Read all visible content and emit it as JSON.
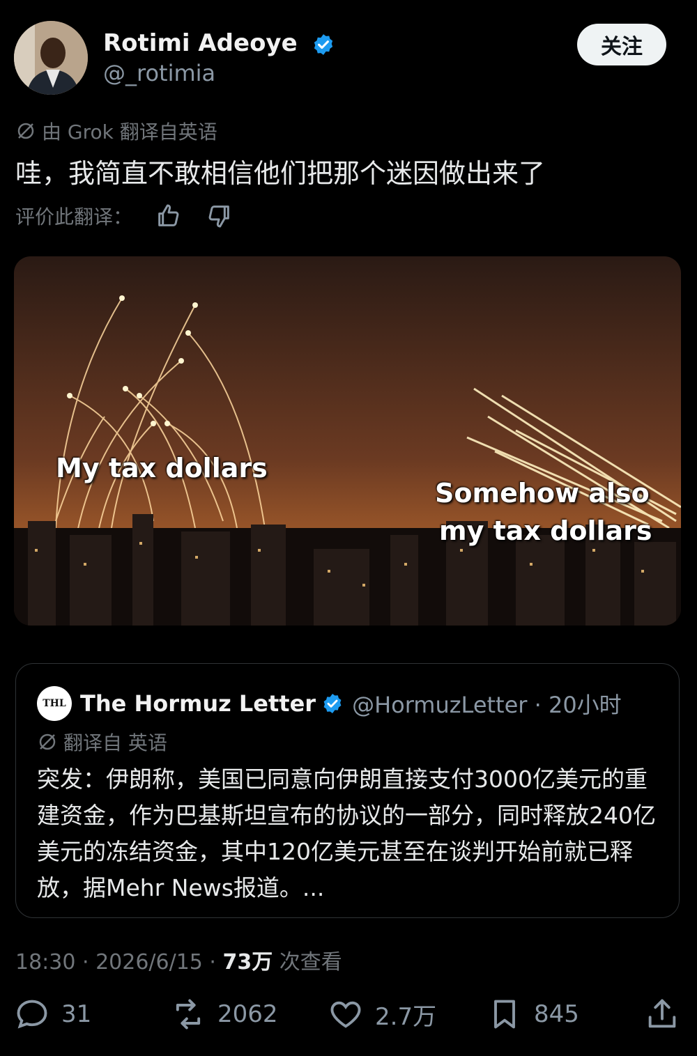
{
  "author": {
    "name": "Rotimi Adeoye",
    "handle": "@_rotimia",
    "follow_label": "关注"
  },
  "translation": {
    "source_note": "由 Grok 翻译自英语",
    "text": "哇，我简直不敢相信他们把那个迷因做出来了",
    "rate_label": "评价此翻译："
  },
  "media": {
    "caption_left": "My tax dollars",
    "caption_right_line1": "Somehow also",
    "caption_right_line2": "my tax dollars"
  },
  "quote": {
    "logo_text": "THL",
    "name": "The Hormuz Letter",
    "handle_time": "@HormuzLetter · 20小时",
    "translated_note": "翻译自 英语",
    "body": "突发：伊朗称，美国已同意向伊朗直接支付3000亿美元的重建资金，作为巴基斯坦宣布的协议的一部分，同时释放240亿美元的冻结资金，其中120亿美元甚至在谈判开始前就已释放，据Mehr News报道。..."
  },
  "meta": {
    "time_date": "18:30 · 2026/6/15 · ",
    "views": "73万",
    "views_label": " 次查看"
  },
  "actions": {
    "replies": "31",
    "reposts": "2062",
    "likes": "2.7万",
    "bookmarks": "845"
  },
  "colors": {
    "accent": "#1d9bf0",
    "background": "#000000",
    "muted": "#71767b"
  }
}
